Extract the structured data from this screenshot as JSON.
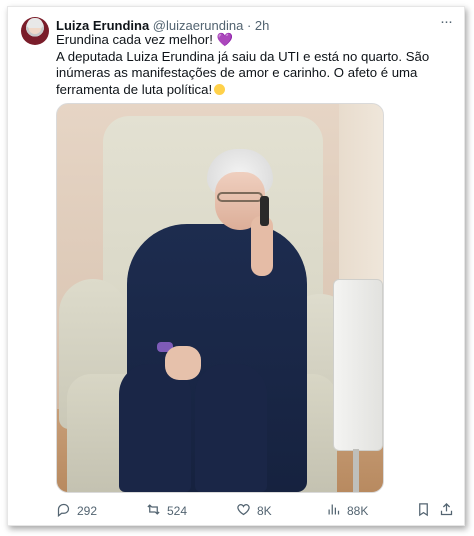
{
  "post": {
    "author_name": "Luiza Erundina",
    "author_handle": "@luizaerundina",
    "separator": "·",
    "timestamp": "2h",
    "more_glyph": "···",
    "line1": "Erundina cada vez melhor!",
    "line1_emoji": "💜",
    "line2": "A deputada Luiza Erundina já saiu da UTI e está no quarto. São inúmeras as manifestações de amor e carinho. O afeto é uma ferramenta de luta política!",
    "line2_emoji": "sun-emoji"
  },
  "media": {
    "description_icon": "photo"
  },
  "actions": {
    "reply_count": "292",
    "repost_count": "524",
    "like_count": "8K",
    "views_count": "88K"
  },
  "icons": [
    "reply-icon",
    "repost-icon",
    "like-icon",
    "views-icon",
    "bookmark-icon",
    "share-icon",
    "more-icon"
  ],
  "colors": {
    "text": "#0f1419",
    "muted": "#536471",
    "heart": "#a77be3"
  }
}
